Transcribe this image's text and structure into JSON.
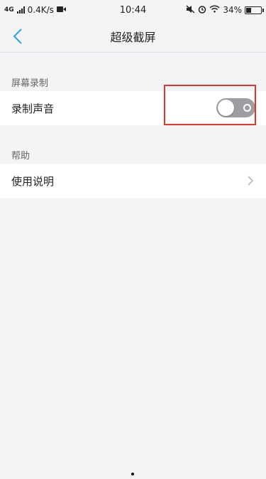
{
  "status_bar": {
    "network": "4G",
    "speed": "0.4K/s",
    "time": "10:44",
    "battery": "34%",
    "battery_level": 0.34
  },
  "header": {
    "title": "超级截屏"
  },
  "sections": {
    "screen_recording": {
      "label": "屏幕录制",
      "record_audio_label": "录制声音",
      "record_audio_enabled": false
    },
    "help": {
      "label": "帮助",
      "instructions_label": "使用说明"
    }
  },
  "colors": {
    "background": "#f4f4f6",
    "accent": "#2aa3e0",
    "toggle_off": "#9e9ea2",
    "highlight": "#e3342f"
  }
}
